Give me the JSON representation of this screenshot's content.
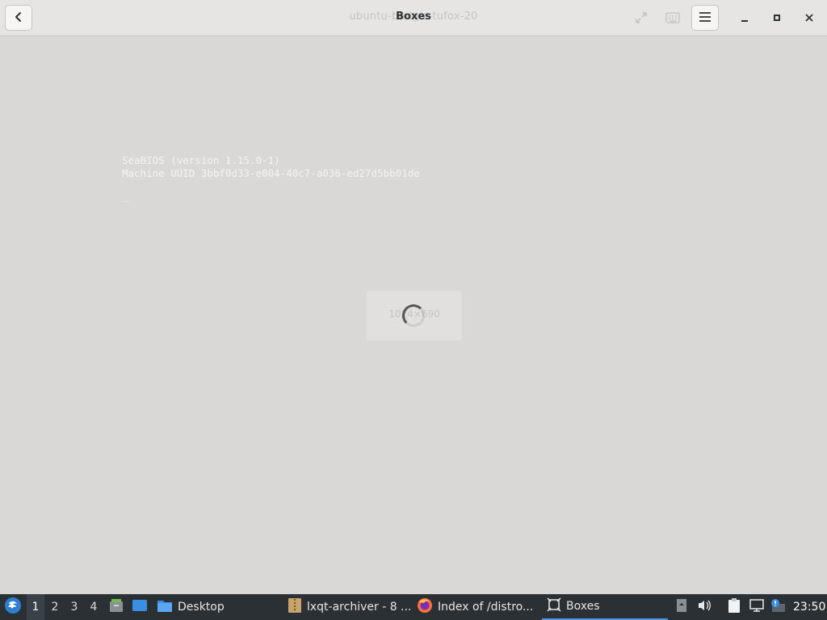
{
  "header": {
    "title": "Boxes",
    "subtitle": "ubuntu-budgie-tufox-20"
  },
  "vm": {
    "bios_line1": "SeaBIOS (version 1.15.0-1)",
    "bios_line2": "Machine UUID 3bbf0d33-e004-40c7-a036-ed27d5bb01de",
    "cursor": "_",
    "resolution": "1024×690"
  },
  "taskbar": {
    "workspaces": [
      "1",
      "2",
      "3",
      "4"
    ],
    "tasks": [
      {
        "label": "Desktop",
        "icon": "folder-icon"
      },
      {
        "label": "lxqt-archiver - 8 ...",
        "icon": "archiver-icon"
      },
      {
        "label": "Index of /distro...",
        "icon": "firefox-icon"
      },
      {
        "label": "Boxes",
        "icon": "boxes-icon"
      }
    ],
    "clock": "23:50"
  },
  "colors": {
    "accent": "#5294e2",
    "taskbar_bg": "#2b3035",
    "display_bg": "#d9d8d6"
  }
}
